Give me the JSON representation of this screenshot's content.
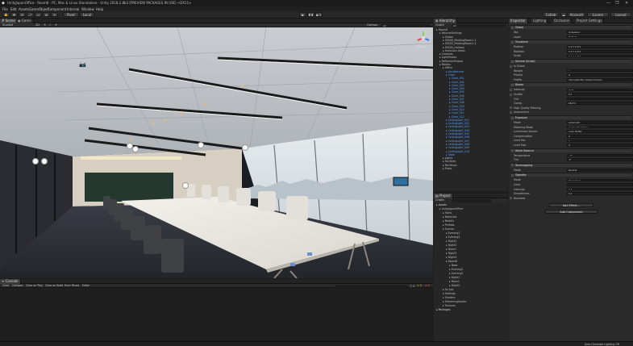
{
  "window": {
    "title": "UnityJapanOffice - Room8 - PC, Mac & Linux Standalone - Unity 2018.2.8b3 [PREVIEW PACKAGES IN USE] <DX11>",
    "min_label": "—",
    "max_label": "❐",
    "close_label": "✕"
  },
  "menu": [
    "File",
    "Edit",
    "Assets",
    "GameObject",
    "Component",
    "Internal",
    "Window",
    "Help"
  ],
  "toolbar": {
    "pivot_label": "Pivot",
    "local_label": "Local",
    "collab_label": "Collab",
    "account_label": "Account",
    "layers_label": "Layers",
    "layout_label": "Layout"
  },
  "scene_tabs": [
    "Scene",
    "Game"
  ],
  "scene_strip": {
    "shading": "Shaded",
    "mode_2d": "2D",
    "gizmos": "Gizmos",
    "search": "All"
  },
  "gizmo": {
    "label": "Persp"
  },
  "bottom_tabs": [
    "Console"
  ],
  "console_strip": {
    "clear": "Clear",
    "collapse": "Collapse",
    "clear_on_play": "Clear on Play",
    "clear_on_build": "Clear on Build",
    "error_pause": "Error Pause",
    "editor": "Editor",
    "count_warn": "0",
    "count_error": "0",
    "count_info": "0"
  },
  "hierarchy": {
    "tab": "Hierarchy",
    "create": "Create",
    "search": "All",
    "items": [
      {
        "t": "Room8",
        "d": 0,
        "k": "scene"
      },
      {
        "t": "VolumeSettings",
        "d": 1,
        "k": "n"
      },
      {
        "t": "Global",
        "d": 2,
        "k": "n"
      },
      {
        "t": "SSSSS_MeetingRoom1-1",
        "d": 2,
        "k": "n"
      },
      {
        "t": "SSSSS_MeetingRoom1-2",
        "d": 2,
        "k": "n"
      },
      {
        "t": "SSSSS_Hallway",
        "d": 2,
        "k": "n"
      },
      {
        "t": "Exclusion Areas",
        "d": 2,
        "k": "n"
      },
      {
        "t": "Cameras",
        "d": 1,
        "k": "n"
      },
      {
        "t": "LightProbes",
        "d": 1,
        "k": "n"
      },
      {
        "t": "ReflectionProbes",
        "d": 1,
        "k": "n"
      },
      {
        "t": "Models",
        "d": 1,
        "k": "n"
      },
      {
        "t": "Office",
        "d": 2,
        "k": "n"
      },
      {
        "t": "Architecture",
        "d": 3,
        "k": "sel"
      },
      {
        "t": "Chair",
        "d": 3,
        "k": "sel"
      },
      {
        "t": "Chair_001",
        "d": 4,
        "k": "sel"
      },
      {
        "t": "Chair_002",
        "d": 4,
        "k": "sel"
      },
      {
        "t": "Chair_003",
        "d": 4,
        "k": "sel"
      },
      {
        "t": "Chair_004",
        "d": 4,
        "k": "sel"
      },
      {
        "t": "Chair_005",
        "d": 4,
        "k": "sel"
      },
      {
        "t": "Chair_006",
        "d": 4,
        "k": "sel"
      },
      {
        "t": "Chair_007",
        "d": 4,
        "k": "sel"
      },
      {
        "t": "Chair_008",
        "d": 4,
        "k": "sel"
      },
      {
        "t": "Chair_009",
        "d": 4,
        "k": "sel"
      },
      {
        "t": "Chair_010",
        "d": 4,
        "k": "sel"
      },
      {
        "t": "Chair_011",
        "d": 4,
        "k": "sel"
      },
      {
        "t": "Chair_012",
        "d": 4,
        "k": "sel"
      },
      {
        "t": "CeilingLight_001",
        "d": 3,
        "k": "sel"
      },
      {
        "t": "CeilingLight_002",
        "d": 3,
        "k": "sel"
      },
      {
        "t": "CeilingLight_003",
        "d": 3,
        "k": "sel"
      },
      {
        "t": "CeilingLight_004",
        "d": 3,
        "k": "sel"
      },
      {
        "t": "CeilingLight_005",
        "d": 3,
        "k": "sel"
      },
      {
        "t": "CeilingLight_006",
        "d": 3,
        "k": "sel"
      },
      {
        "t": "CeilingLight_007",
        "d": 3,
        "k": "sel"
      },
      {
        "t": "CeilingLight_008",
        "d": 3,
        "k": "sel"
      },
      {
        "t": "CeilingLight_009",
        "d": 3,
        "k": "sel"
      },
      {
        "t": "CeilingLight_010",
        "d": 3,
        "k": "sel"
      },
      {
        "t": "Table",
        "d": 3,
        "k": "sel"
      },
      {
        "t": "Lights",
        "d": 2,
        "k": "n"
      },
      {
        "t": "Facilities",
        "d": 2,
        "k": "n"
      },
      {
        "t": "Partitions",
        "d": 2,
        "k": "n"
      },
      {
        "t": "Props",
        "d": 2,
        "k": "n"
      }
    ]
  },
  "project": {
    "tab": "Project",
    "create": "Create",
    "items": [
      {
        "t": "Assets",
        "d": 0,
        "k": "gold"
      },
      {
        "t": "UnityJapanOffice",
        "d": 1,
        "k": "n"
      },
      {
        "t": "Fonts",
        "d": 2,
        "k": "n"
      },
      {
        "t": "Materials",
        "d": 2,
        "k": "n"
      },
      {
        "t": "Models",
        "d": 2,
        "k": "n"
      },
      {
        "t": "Prefabs",
        "d": 2,
        "k": "n"
      },
      {
        "t": "Scenes",
        "d": 2,
        "k": "n"
      },
      {
        "t": "Evening1",
        "d": 3,
        "k": "n"
      },
      {
        "t": "Evening2",
        "d": 3,
        "k": "n"
      },
      {
        "t": "Night1",
        "d": 3,
        "k": "n"
      },
      {
        "t": "Night2",
        "d": 3,
        "k": "n"
      },
      {
        "t": "Noon1",
        "d": 3,
        "k": "n"
      },
      {
        "t": "Night3",
        "d": 3,
        "k": "n"
      },
      {
        "t": "Night4",
        "d": 3,
        "k": "n"
      },
      {
        "t": "Room8",
        "d": 3,
        "k": "n"
      },
      {
        "t": "Base",
        "d": 4,
        "k": "n"
      },
      {
        "t": "Evening1",
        "d": 4,
        "k": "n"
      },
      {
        "t": "Evening2",
        "d": 4,
        "k": "n"
      },
      {
        "t": "Night1",
        "d": 4,
        "k": "n"
      },
      {
        "t": "Noon1",
        "d": 4,
        "k": "n"
      },
      {
        "t": "Night2",
        "d": 4,
        "k": "n"
      },
      {
        "t": "Scripts",
        "d": 2,
        "k": "n"
      },
      {
        "t": "Settings",
        "d": 2,
        "k": "n"
      },
      {
        "t": "Shaders",
        "d": 2,
        "k": "n"
      },
      {
        "t": "StreamingAssets",
        "d": 2,
        "k": "n"
      },
      {
        "t": "Textures",
        "d": 2,
        "k": "n"
      },
      {
        "t": "Packages",
        "d": 0,
        "k": "gold"
      }
    ]
  },
  "inspector": {
    "tabs": [
      "Inspector",
      "Lighting",
      "Occlusion",
      "Project Settings"
    ],
    "rows": [
      {
        "l": "Global",
        "k": "section"
      },
      {
        "l": "Tag",
        "v": "Untagged"
      },
      {
        "l": "Layer",
        "v": "Default"
      },
      {
        "l": "Transform",
        "k": "section"
      },
      {
        "l": "Position",
        "v": "X 0    Y 0    Z 0"
      },
      {
        "l": "Rotation",
        "v": "X 0    Y 0    Z 0"
      },
      {
        "l": "Scale",
        "v": "X 1    Y 1    Z 1"
      },
      {
        "l": "Volume (Script)",
        "k": "section"
      },
      {
        "l": "Is Global",
        "k": "check"
      },
      {
        "l": "Weight",
        "v": "1"
      },
      {
        "l": "Priority",
        "v": "0"
      },
      {
        "l": "Profile",
        "v": "VolumeProfile_Global (Volume"
      },
      {
        "l": "Bloom",
        "k": "section"
      },
      {
        "l": "Intensity",
        "v": "0.05",
        "k": "check"
      },
      {
        "l": "Scatter",
        "v": "0.7",
        "k": "check"
      },
      {
        "l": "Tint",
        "v": ""
      },
      {
        "l": "Clamp",
        "v": "65472"
      },
      {
        "l": "High Quality Filtering",
        "k": "check"
      },
      {
        "l": "Anamorphic",
        "k": "check"
      },
      {
        "l": "Exposure",
        "k": "section"
      },
      {
        "l": "Mode",
        "v": "Automatic"
      },
      {
        "l": "Metering Mode",
        "v": "Center Weighted"
      },
      {
        "l": "Luminance Source",
        "v": "Color Buffer"
      },
      {
        "l": "Compensation",
        "v": "0"
      },
      {
        "l": "Limit Min",
        "v": "0"
      },
      {
        "l": "Limit Max",
        "v": "0"
      },
      {
        "l": "White Balance",
        "k": "section"
      },
      {
        "l": "Temperature",
        "v": "-20"
      },
      {
        "l": "Tint",
        "v": "-5"
      },
      {
        "l": "Tonemapping",
        "k": "section"
      },
      {
        "l": "Mode",
        "v": "Neutral"
      },
      {
        "l": "Vignette",
        "k": "section"
      },
      {
        "l": "Mode",
        "v": "Procedural"
      },
      {
        "l": "Color",
        "v": ""
      },
      {
        "l": "Intensity",
        "v": "0.3"
      },
      {
        "l": "Smoothness",
        "v": "0.2"
      },
      {
        "l": "Rounded",
        "k": "check"
      }
    ],
    "add_effect": "Add Effect...",
    "add_component": "Add Component"
  },
  "status": {
    "right": "Auto Generate Lighting Off"
  }
}
